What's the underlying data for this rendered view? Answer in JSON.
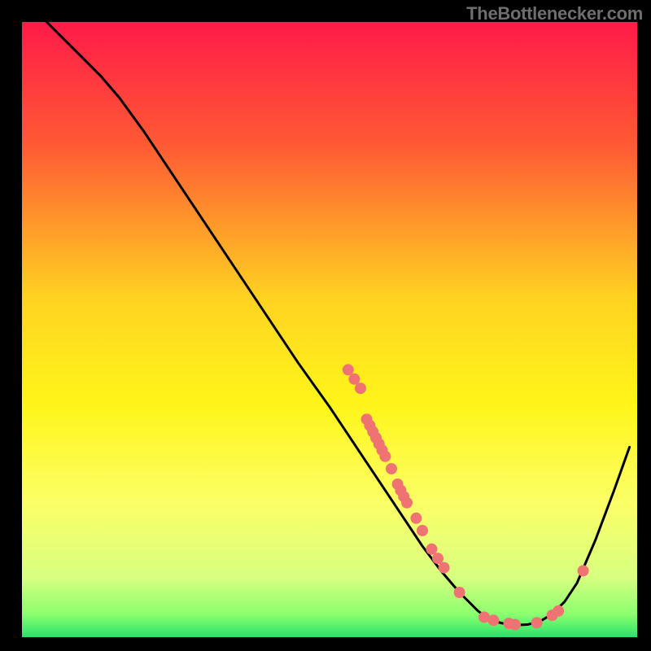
{
  "watermark": "TheBottlenecker.com",
  "chart_data": {
    "type": "line",
    "title": "",
    "xlabel": "",
    "ylabel": "",
    "xlim": [
      0,
      100
    ],
    "ylim": [
      0,
      100
    ],
    "grid": false,
    "gradient_stops": [
      {
        "offset": 0.0,
        "color": "#ff1a49"
      },
      {
        "offset": 0.2,
        "color": "#ff5934"
      },
      {
        "offset": 0.45,
        "color": "#ffd321"
      },
      {
        "offset": 0.62,
        "color": "#fff51a"
      },
      {
        "offset": 0.78,
        "color": "#fcff66"
      },
      {
        "offset": 0.9,
        "color": "#d8ff80"
      },
      {
        "offset": 0.96,
        "color": "#8cff6e"
      },
      {
        "offset": 1.0,
        "color": "#22e06a"
      }
    ],
    "curve_points": [
      {
        "x": 4.0,
        "y": 100.0
      },
      {
        "x": 7.0,
        "y": 97.0
      },
      {
        "x": 10.0,
        "y": 94.0
      },
      {
        "x": 13.0,
        "y": 91.0
      },
      {
        "x": 16.0,
        "y": 87.5
      },
      {
        "x": 20.0,
        "y": 82.0
      },
      {
        "x": 25.0,
        "y": 74.5
      },
      {
        "x": 30.0,
        "y": 67.0
      },
      {
        "x": 35.0,
        "y": 59.5
      },
      {
        "x": 40.0,
        "y": 52.0
      },
      {
        "x": 45.0,
        "y": 44.5
      },
      {
        "x": 50.0,
        "y": 37.5
      },
      {
        "x": 53.0,
        "y": 33.0
      },
      {
        "x": 56.0,
        "y": 28.5
      },
      {
        "x": 59.0,
        "y": 24.0
      },
      {
        "x": 62.0,
        "y": 19.5
      },
      {
        "x": 65.0,
        "y": 15.0
      },
      {
        "x": 68.0,
        "y": 11.0
      },
      {
        "x": 71.0,
        "y": 7.5
      },
      {
        "x": 74.0,
        "y": 4.5
      },
      {
        "x": 76.0,
        "y": 3.0
      },
      {
        "x": 78.0,
        "y": 2.5
      },
      {
        "x": 80.0,
        "y": 2.2
      },
      {
        "x": 82.0,
        "y": 2.3
      },
      {
        "x": 84.0,
        "y": 2.8
      },
      {
        "x": 86.0,
        "y": 4.0
      },
      {
        "x": 88.0,
        "y": 6.0
      },
      {
        "x": 90.0,
        "y": 9.0
      },
      {
        "x": 93.0,
        "y": 16.0
      },
      {
        "x": 96.0,
        "y": 24.0
      },
      {
        "x": 98.5,
        "y": 31.0
      }
    ],
    "scatter_points": [
      {
        "x": 53.0,
        "y": 43.5
      },
      {
        "x": 54.0,
        "y": 42.0
      },
      {
        "x": 55.0,
        "y": 40.5
      },
      {
        "x": 56.0,
        "y": 35.5
      },
      {
        "x": 56.5,
        "y": 34.5
      },
      {
        "x": 57.0,
        "y": 33.5
      },
      {
        "x": 57.5,
        "y": 32.5
      },
      {
        "x": 58.0,
        "y": 31.5
      },
      {
        "x": 58.5,
        "y": 30.5
      },
      {
        "x": 59.0,
        "y": 29.5
      },
      {
        "x": 60.0,
        "y": 27.5
      },
      {
        "x": 61.0,
        "y": 25.0
      },
      {
        "x": 61.5,
        "y": 24.0
      },
      {
        "x": 62.0,
        "y": 23.0
      },
      {
        "x": 62.5,
        "y": 22.0
      },
      {
        "x": 64.0,
        "y": 19.5
      },
      {
        "x": 65.0,
        "y": 17.5
      },
      {
        "x": 66.5,
        "y": 14.5
      },
      {
        "x": 67.5,
        "y": 13.0
      },
      {
        "x": 68.5,
        "y": 11.5
      },
      {
        "x": 71.0,
        "y": 7.5
      },
      {
        "x": 75.0,
        "y": 3.5
      },
      {
        "x": 76.5,
        "y": 3.0
      },
      {
        "x": 79.0,
        "y": 2.5
      },
      {
        "x": 80.0,
        "y": 2.3
      },
      {
        "x": 83.5,
        "y": 2.6
      },
      {
        "x": 86.0,
        "y": 3.8
      },
      {
        "x": 87.0,
        "y": 4.5
      },
      {
        "x": 91.0,
        "y": 11.0
      }
    ],
    "marker_color": "#ef7373",
    "line_color": "#000000"
  }
}
